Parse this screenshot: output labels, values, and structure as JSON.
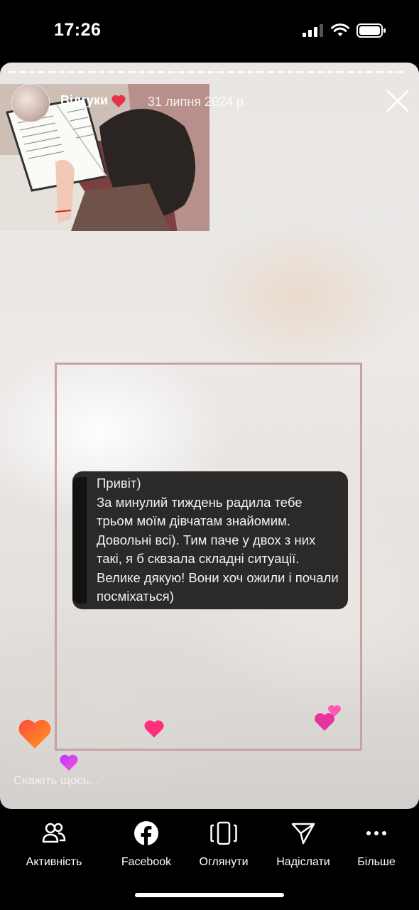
{
  "status_bar": {
    "time": "17:26"
  },
  "story": {
    "author": "Відгуки",
    "date": "31 липня 2024 р.",
    "message": "Привіт)\nЗа минулий тиждень радила тебе трьом моїм дівчатам знайомим. Довольні всі). Тим паче у двох з них такі, я б сквзала складні ситуації. Велике дякую! Вони хоч ожили і почали посміхаться)",
    "reply_placeholder": "Скажіть щось..."
  },
  "bottom_nav": {
    "items": [
      {
        "label": "Активність",
        "icon": "people-icon"
      },
      {
        "label": "Facebook",
        "icon": "facebook-icon"
      },
      {
        "label": "Оглянути",
        "icon": "browse-icon"
      },
      {
        "label": "Надіслати",
        "icon": "send-icon"
      },
      {
        "label": "Більше",
        "icon": "more-icon"
      }
    ]
  },
  "colors": {
    "frame": "#c9a3a0",
    "bubble": "#2b2a29",
    "heart_red": "#e8324a",
    "heart_pink": "#ff2f7d"
  }
}
